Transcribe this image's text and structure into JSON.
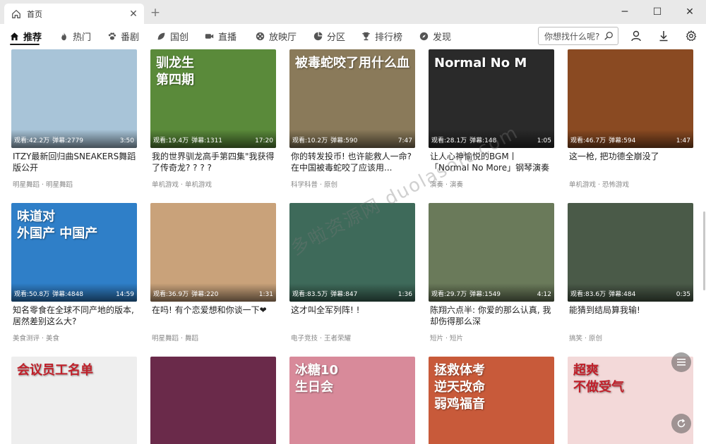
{
  "tab": {
    "label": "首页",
    "close": "✕",
    "new_tab": "+"
  },
  "window": {
    "minimize": "─",
    "maximize": "☐",
    "close": "✕"
  },
  "nav": {
    "items": [
      {
        "label": "推荐",
        "icon": "home-icon",
        "active": true
      },
      {
        "label": "热门",
        "icon": "flame-icon"
      },
      {
        "label": "番剧",
        "icon": "paw-icon"
      },
      {
        "label": "国创",
        "icon": "leaf-icon"
      },
      {
        "label": "直播",
        "icon": "video-camera-icon"
      },
      {
        "label": "放映厅",
        "icon": "film-icon"
      },
      {
        "label": "分区",
        "icon": "pie-icon"
      },
      {
        "label": "排行榜",
        "icon": "trophy-icon"
      },
      {
        "label": "发现",
        "icon": "compass-icon"
      }
    ]
  },
  "search": {
    "placeholder": "你想找什么呢?"
  },
  "watermark": "多啦资源网 duolasoft.com",
  "videos": [
    {
      "views": "观看:42.2万",
      "danmaku": "弹幕:2779",
      "duration": "3:50",
      "title": "ITZY最新回归曲SNEAKERS舞蹈版公开",
      "tags": "明星舞蹈 · 明星舞蹈",
      "bg": "#a8c4d8",
      "overlay": ""
    },
    {
      "views": "观看:19.4万",
      "danmaku": "弹幕:1311",
      "duration": "17:20",
      "title": "我的世界驯龙高手第四集\"我获得了传奇龙? ? ? ?",
      "tags": "单机游戏 · 单机游戏",
      "bg": "#5a8a3a",
      "overlay": "驯龙生\n第四期"
    },
    {
      "views": "观看:10.2万",
      "danmaku": "弹幕:590",
      "duration": "7:47",
      "title": "你的转发投币! 也许能救人一命? 在中国被毒蛇咬了应该用...",
      "tags": "科学科普 · 原创",
      "bg": "#8a7a5a",
      "overlay": "被毒蛇咬了用什么血"
    },
    {
      "views": "观看:28.1万",
      "danmaku": "弹幕:148",
      "duration": "1:05",
      "title": "让人心神愉悦的BGM丨「Normal No More」钢琴演奏",
      "tags": "演奏 · 演奏",
      "bg": "#2a2a2a",
      "overlay": "Normal No M"
    },
    {
      "views": "观看:46.7万",
      "danmaku": "弹幕:594",
      "duration": "1:47",
      "title": "这一枪, 把功德全崩没了",
      "tags": "单机游戏 · 恐怖游戏",
      "bg": "#8a4a22",
      "overlay": ""
    },
    {
      "views": "观看:50.8万",
      "danmaku": "弹幕:4848",
      "duration": "14:59",
      "title": "知名零食在全球不同产地的版本, 居然差别这么大?",
      "tags": "美食测评 · 美食",
      "bg": "#2f7fc8",
      "overlay": "味道对\n外国产 中国产"
    },
    {
      "views": "观看:36.9万",
      "danmaku": "弹幕:220",
      "duration": "1:31",
      "title": "在吗! 有个恋爱想和你谈一下❤",
      "tags": "明星舞蹈 · 舞蹈",
      "bg": "#c9a27a",
      "overlay": ""
    },
    {
      "views": "观看:83.5万",
      "danmaku": "弹幕:847",
      "duration": "1:36",
      "title": "这才叫全军列阵! !",
      "tags": "电子竞技 · 王者荣耀",
      "bg": "#3e6a5a",
      "overlay": ""
    },
    {
      "views": "观看:29.7万",
      "danmaku": "弹幕:1549",
      "duration": "4:12",
      "title": "陈翔六点半: 你爱的那么认真, 我却伤得那么深",
      "tags": "短片 · 短片",
      "bg": "#6a7a5a",
      "overlay": ""
    },
    {
      "views": "观看:83.6万",
      "danmaku": "弹幕:484",
      "duration": "0:35",
      "title": "能猜到结局算我输!",
      "tags": "搞笑 · 原创",
      "bg": "#4a5a48",
      "overlay": ""
    },
    {
      "views": "",
      "danmaku": "",
      "duration": "",
      "title": "",
      "tags": "",
      "bg": "#eeeeee",
      "overlay": "会议员工名单"
    },
    {
      "views": "",
      "danmaku": "",
      "duration": "",
      "title": "",
      "tags": "",
      "bg": "#6a2a4a",
      "overlay": ""
    },
    {
      "views": "",
      "danmaku": "",
      "duration": "",
      "title": "",
      "tags": "",
      "bg": "#d88a9a",
      "overlay": "冰糖10\n生日会"
    },
    {
      "views": "",
      "danmaku": "",
      "duration": "",
      "title": "",
      "tags": "",
      "bg": "#c85a3a",
      "overlay": "拯救体考\n逆天改命\n弱鸡福音"
    },
    {
      "views": "",
      "danmaku": "",
      "duration": "",
      "title": "",
      "tags": "",
      "bg": "#f3d9d9",
      "overlay": "超爽\n不做受气"
    }
  ]
}
